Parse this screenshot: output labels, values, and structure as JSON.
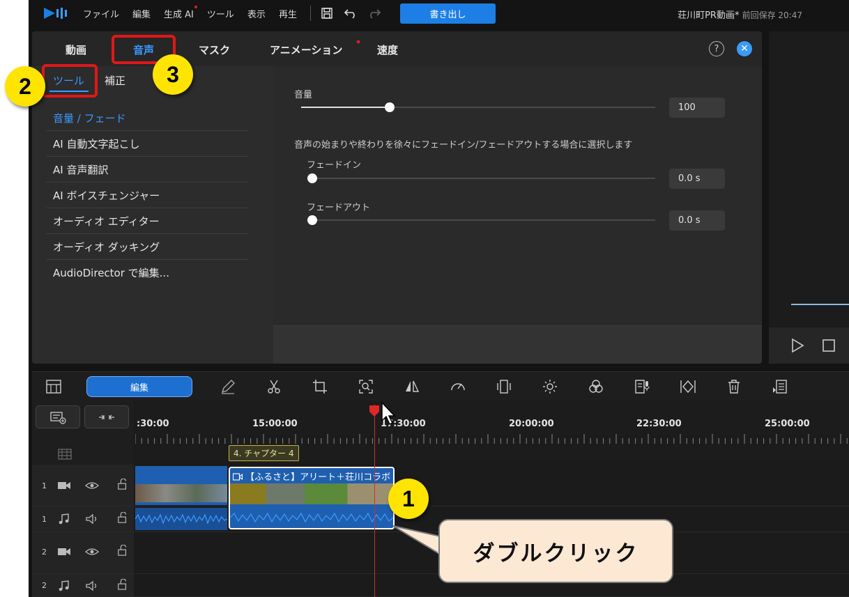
{
  "menubar": {
    "items": [
      "ファイル",
      "編集",
      "生成 AI",
      "ツール",
      "表示",
      "再生"
    ],
    "export_label": "書き出し",
    "project_name": "荘川町PR動画*",
    "saved_text": "前回保存 20:47"
  },
  "panel": {
    "tabs": [
      "動画",
      "音声",
      "マスク",
      "アニメーション",
      "速度"
    ],
    "help": "?",
    "subtabs": [
      "ツール",
      "補正"
    ],
    "tools": [
      "音量 / フェード",
      "AI 自動文字起こし",
      "AI 音声翻訳",
      "AI ボイスチェンジャー",
      "オーディオ エディター",
      "オーディオ ダッキング",
      "AudioDirector で編集..."
    ],
    "volume_label": "音量",
    "volume_value": "100",
    "volume_level": 100,
    "fade_desc": "音声の始まりや終わりを徐々にフェードイン/フェードアウトする場合に選択します",
    "fade_in_label": "フェードイン",
    "fade_in_value": "0.0 s",
    "fade_out_label": "フェードアウト",
    "fade_out_value": "0.0 s"
  },
  "timeline": {
    "edit_label": "編集",
    "times": [
      ":30:00",
      "15:00:00",
      "17:30:00",
      "20:00:00",
      "22:30:00",
      "25:00:00"
    ],
    "chapter": "4. チャプター 4",
    "clip_title": "【ふるさと】アリート＋荘川コラボ",
    "tracks": [
      "1",
      "1",
      "2",
      "2"
    ]
  },
  "annotations": {
    "n1": "1",
    "n2": "2",
    "n3": "3",
    "callout": "ダブルクリック"
  },
  "colors": {
    "accent": "#3b9bff",
    "export": "#1d7fe6",
    "playhead": "#e02828",
    "marker_yellow": "#ffe400",
    "highlight_red": "#e01818"
  }
}
